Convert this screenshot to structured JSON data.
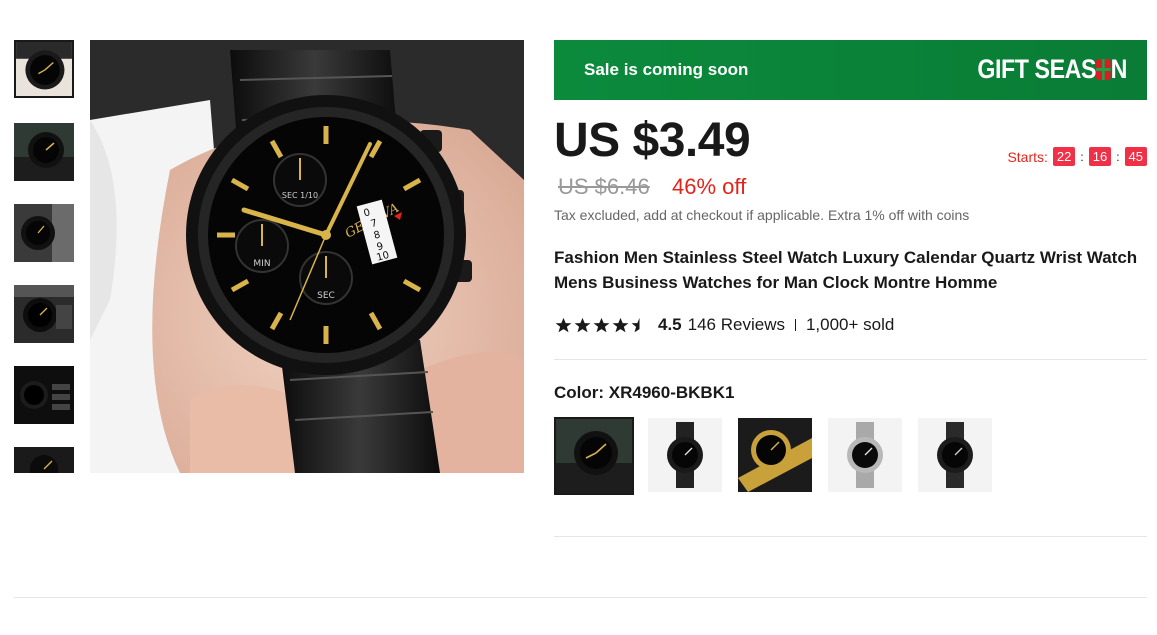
{
  "gallery": {
    "thumbnails": [
      {
        "name": "thumb-1",
        "active": true
      },
      {
        "name": "thumb-2",
        "active": false
      },
      {
        "name": "thumb-3",
        "active": false
      },
      {
        "name": "thumb-4",
        "active": false
      },
      {
        "name": "thumb-5",
        "active": false
      },
      {
        "name": "thumb-6",
        "active": false
      }
    ],
    "watch_dial": {
      "brand": "GENEVA",
      "sub_dial_min": "MIN",
      "sub_dial_sec": "SEC",
      "sub_dial_sec_top": "SEC 1/10",
      "date_digits": [
        "0",
        "7",
        "8",
        "9",
        "10"
      ]
    }
  },
  "banner": {
    "sale_text": "Sale is coming soon",
    "gift_text_a": "GIFT SEAS",
    "gift_text_b": "N"
  },
  "price": {
    "current": "US $3.49",
    "original": "US $6.46",
    "discount": "46% off",
    "tax_note": "Tax excluded, add at checkout if applicable. Extra 1% off with coins"
  },
  "countdown": {
    "label": "Starts:",
    "hours": "22",
    "minutes": "16",
    "seconds": "45",
    "separator": ":"
  },
  "product": {
    "title": "Fashion Men Stainless Steel Watch Luxury Calendar Quartz Wrist Watch Mens Business Watches for Man Clock Montre Homme",
    "rating": 4.5,
    "rating_text": "4.5",
    "reviews": "146 Reviews",
    "sold": "1,000+ sold"
  },
  "variants": {
    "label": "Color: XR4960-BKBK1",
    "options": [
      {
        "name": "swatch-black-gold-closeup",
        "selected": true
      },
      {
        "name": "swatch-black-white",
        "selected": false
      },
      {
        "name": "swatch-gold",
        "selected": false
      },
      {
        "name": "swatch-silver",
        "selected": false
      },
      {
        "name": "swatch-black-silver",
        "selected": false
      }
    ]
  },
  "colors": {
    "accent_red": "#e1251b",
    "banner_green": "#0b8a3c",
    "countdown_red": "#f03046",
    "text": "#191919"
  }
}
